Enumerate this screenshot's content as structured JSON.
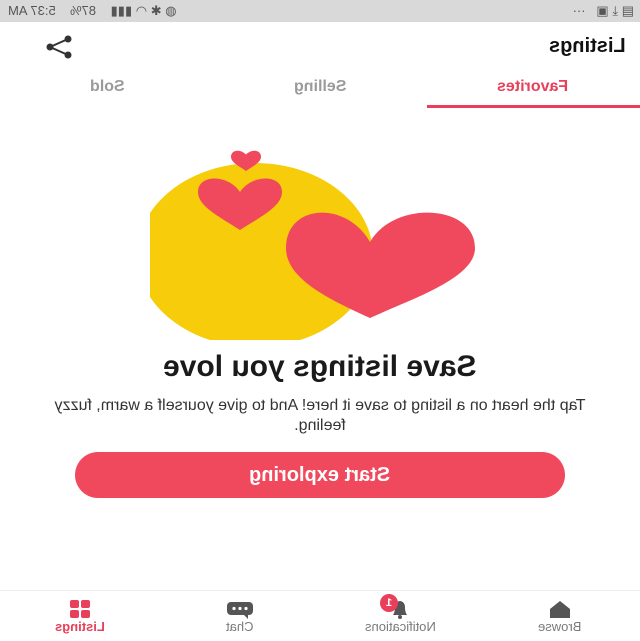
{
  "status_bar": {
    "time": "5:37 AM",
    "battery": "87%",
    "icons": [
      "signal-icon",
      "wifi-icon",
      "bluetooth-icon",
      "location-icon"
    ]
  },
  "app_bar": {
    "title": "Listings",
    "share_icon": "share-icon"
  },
  "tabs": [
    {
      "label": "Favorites",
      "active": true
    },
    {
      "label": "Selling",
      "active": false
    },
    {
      "label": "Sold",
      "active": false
    }
  ],
  "empty_state": {
    "headline": "Save listings you love",
    "subtext": "Tap the heart on a listing to save it here! And to give yourself a warm, fuzzy feeling.",
    "cta_label": "Start exploring"
  },
  "bottom_nav": [
    {
      "label": "Browse",
      "icon": "home-icon",
      "active": false
    },
    {
      "label": "Notifications",
      "icon": "bell-icon",
      "badge": "1",
      "active": false
    },
    {
      "label": "Chat",
      "icon": "chat-icon",
      "active": false
    },
    {
      "label": "Listings",
      "icon": "grid-icon",
      "active": true
    }
  ],
  "colors": {
    "accent": "#e8405a",
    "illustration_yellow": "#f6cc0b",
    "illustration_heart": "#f0485c"
  }
}
